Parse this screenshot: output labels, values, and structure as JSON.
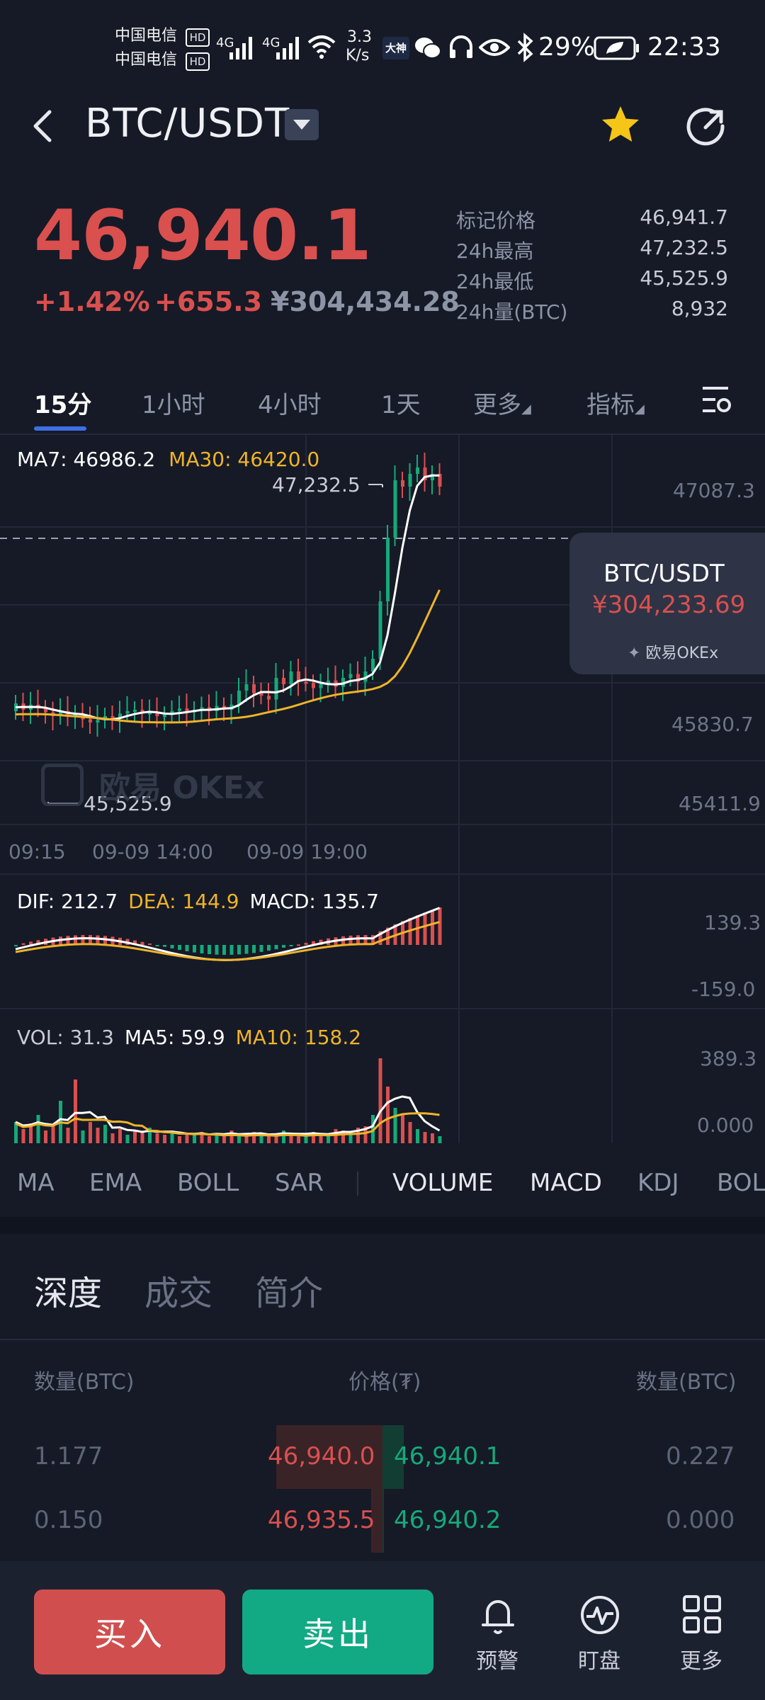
{
  "status_bar": {
    "carrier1": "中国电信",
    "carrier2": "中国电信",
    "hd": "HD",
    "net1": "4G",
    "net2": "4G",
    "speed_value": "3.3",
    "speed_unit": "K/s",
    "app_badge": "大神",
    "battery": "29%",
    "time": "22:33"
  },
  "header": {
    "title": "BTC/USDT"
  },
  "price": {
    "last": "46,940.1",
    "change_pct": "+1.42%",
    "change_abs": "+655.3",
    "cny": "¥304,434.28",
    "stats": [
      {
        "label": "标记价格",
        "value": "46,941.7"
      },
      {
        "label": "24h最高",
        "value": "47,232.5"
      },
      {
        "label": "24h最低",
        "value": "45,525.9"
      },
      {
        "label": "24h量(BTC)",
        "value": "8,932"
      }
    ]
  },
  "tabs": {
    "items": [
      "15分",
      "1小时",
      "4小时",
      "1天",
      "更多",
      "指标"
    ]
  },
  "chart": {
    "ma7_label": "MA7: 46986.2",
    "ma30_label": "MA30: 46420.0",
    "high_marker": "47,232.5",
    "low_marker": "45,525.9",
    "right_axis": [
      "47087.3",
      "45830.7",
      "45411.9"
    ],
    "time_axis": [
      "09:15",
      "09-09 14:00",
      "09-09 19:00"
    ],
    "watermark": "欧易 OKEx",
    "tooltip_pair": "BTC/USDT",
    "tooltip_price": "¥304,233.69",
    "tooltip_brand": "欧易OKEx",
    "macd_legend": {
      "dif": "DIF: 212.7",
      "dea": "DEA: 144.9",
      "macd": "MACD: 135.7"
    },
    "macd_axis": [
      "139.3",
      "-159.0"
    ],
    "vol_legend": {
      "vol": "VOL: 31.3",
      "ma5": "MA5: 59.9",
      "ma10": "MA10: 158.2"
    },
    "vol_axis": [
      "389.3",
      "0.000"
    ]
  },
  "indicators": {
    "items": [
      "MA",
      "EMA",
      "BOLL",
      "SAR",
      "VOLUME",
      "MACD",
      "KDJ",
      "BOL"
    ]
  },
  "depth": {
    "tabs": [
      "深度",
      "成交",
      "简介"
    ],
    "head_left": "数量(BTC)",
    "head_mid": "价格(₮)",
    "head_right": "数量(BTC)",
    "rows": [
      {
        "bid_qty": "1.177",
        "bid_price": "46,940.0",
        "ask_price": "46,940.1",
        "ask_qty": "0.227"
      },
      {
        "bid_qty": "0.150",
        "bid_price": "46,935.5",
        "ask_price": "46,940.2",
        "ask_qty": "0.000"
      }
    ]
  },
  "bottom": {
    "buy": "买入",
    "sell": "卖出",
    "alert": "预警",
    "watch": "盯盘",
    "more": "更多"
  },
  "colors": {
    "up": "#d9504f",
    "down": "#16a97a",
    "accent": "#3e6fe6",
    "ma30": "#f0b429",
    "star": "#f5c518"
  }
}
